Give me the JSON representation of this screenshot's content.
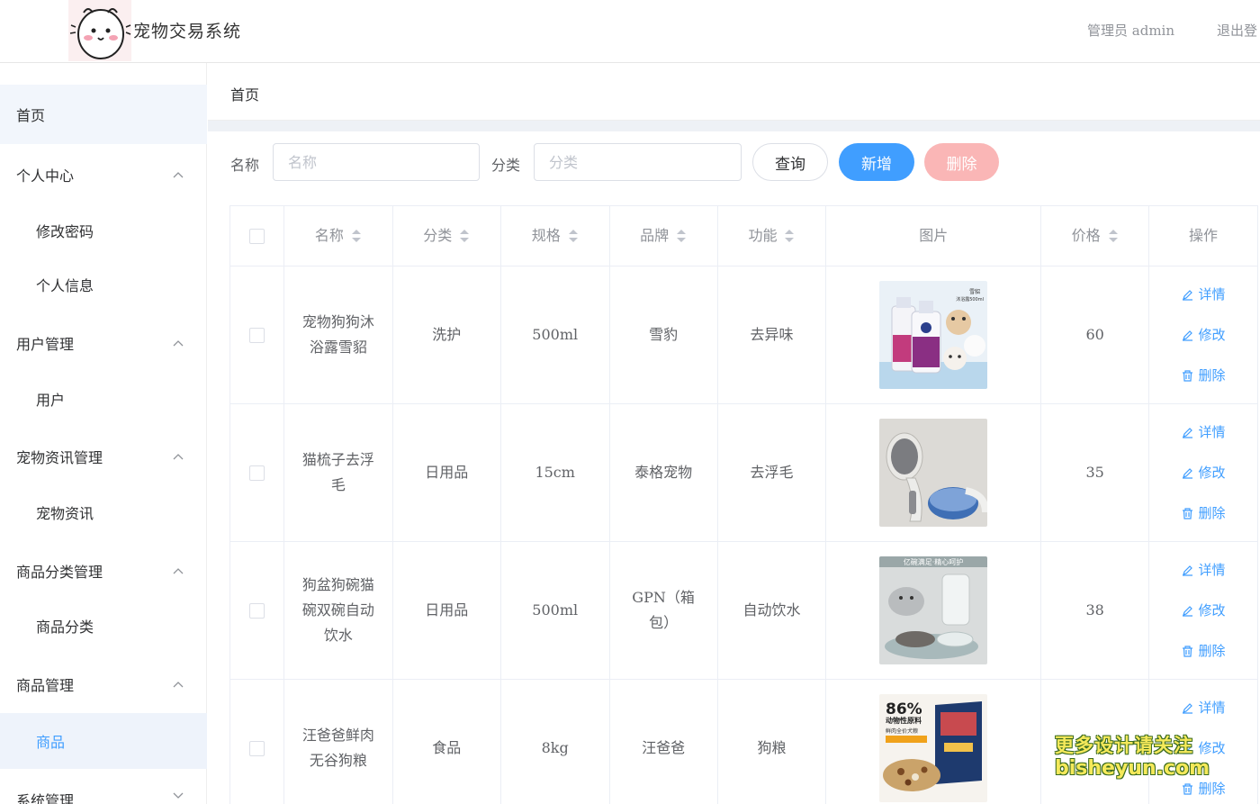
{
  "header": {
    "app_title": "宠物交易系统",
    "admin_label": "管理员 admin",
    "logout_label": "退出登"
  },
  "sidebar": {
    "items": [
      {
        "label": "首页",
        "type": "home"
      },
      {
        "label": "个人中心",
        "type": "group",
        "expanded": true
      },
      {
        "label": "修改密码",
        "type": "sub"
      },
      {
        "label": "个人信息",
        "type": "sub"
      },
      {
        "label": "用户管理",
        "type": "group",
        "expanded": true
      },
      {
        "label": "用户",
        "type": "sub"
      },
      {
        "label": "宠物资讯管理",
        "type": "group",
        "expanded": true
      },
      {
        "label": "宠物资讯",
        "type": "sub"
      },
      {
        "label": "商品分类管理",
        "type": "group",
        "expanded": true
      },
      {
        "label": "商品分类",
        "type": "sub"
      },
      {
        "label": "商品管理",
        "type": "group",
        "expanded": true
      },
      {
        "label": "商品",
        "type": "sub",
        "active": true
      },
      {
        "label": "系统管理",
        "type": "group",
        "expanded": false
      }
    ]
  },
  "breadcrumb": {
    "current": "首页"
  },
  "search": {
    "name_label": "名称",
    "name_placeholder": "名称",
    "category_label": "分类",
    "category_placeholder": "分类",
    "query_label": "查询",
    "add_label": "新增",
    "delete_label": "删除"
  },
  "table": {
    "columns": [
      "名称",
      "分类",
      "规格",
      "品牌",
      "功能",
      "图片",
      "价格",
      "操作"
    ],
    "rows": [
      {
        "name": "宠物狗狗沐浴露雪貂",
        "category": "洗护",
        "spec": "500ml",
        "brand": "雪豹",
        "function": "去异味",
        "image": "shampoo-bottles",
        "price": "60"
      },
      {
        "name": "猫梳子去浮毛",
        "category": "日用品",
        "spec": "15cm",
        "brand": "泰格宠物",
        "function": "去浮毛",
        "image": "pet-comb",
        "price": "35"
      },
      {
        "name": "狗盆狗碗猫碗双碗自动饮水",
        "category": "日用品",
        "spec": "500ml",
        "brand": "GPN（箱包）",
        "function": "自动饮水",
        "image": "pet-bowl",
        "price": "38"
      },
      {
        "name": "汪爸爸鲜肉无谷狗粮",
        "category": "食品",
        "spec": "8kg",
        "brand": "汪爸爸",
        "function": "狗粮",
        "image": "dog-food",
        "price": ""
      }
    ],
    "ops": {
      "detail": "详情",
      "edit": "修改",
      "delete": "删除"
    },
    "image_text": {
      "shampoo_brand": "雪貂",
      "shampoo_size": "沐浴露500ml",
      "bowl_banner": "亿碗满足·精心呵护",
      "food_percent": "86%",
      "food_line1": "动物性原料",
      "food_line2": "鲜肉全价犬粮"
    }
  },
  "watermark": {
    "line1": "更多设计请关注",
    "line2": "bisheyun.com"
  },
  "colors": {
    "primary": "#409eff",
    "danger_light": "#fab6b6",
    "active_bg": "#eef3fb"
  }
}
